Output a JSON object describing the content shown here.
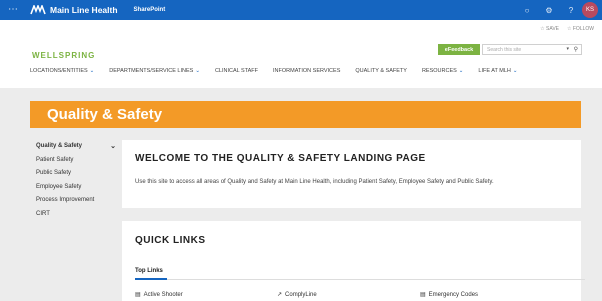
{
  "suitebar": {
    "brand": "Main Line Health",
    "app": "SharePoint",
    "avatar_initials": "KS"
  },
  "header": {
    "actions": [
      "SAVE",
      "FOLLOW"
    ],
    "logo": "WELLSPRING",
    "efeedback": "eFeedback",
    "search_placeholder": "Search this site",
    "nav": [
      {
        "label": "LOCATIONS/ENTITIES",
        "dropdown": true
      },
      {
        "label": "DEPARTMENTS/SERVICE LINES",
        "dropdown": true
      },
      {
        "label": "CLINICAL STAFF",
        "dropdown": false
      },
      {
        "label": "INFORMATION SERVICES",
        "dropdown": false
      },
      {
        "label": "QUALITY & SAFETY",
        "dropdown": false
      },
      {
        "label": "RESOURCES",
        "dropdown": true
      },
      {
        "label": "LIFE AT MLH",
        "dropdown": true
      }
    ]
  },
  "banner": {
    "title": "Quality & Safety"
  },
  "leftnav": {
    "items": [
      "Quality & Safety",
      "Patient Safety",
      "Public Safety",
      "Employee Safety",
      "Process Improvement",
      "CIRT"
    ]
  },
  "welcome": {
    "title": "WELCOME TO THE QUALITY & SAFETY LANDING PAGE",
    "text": "Use this site to access all areas of Quality and Safety at Main Line Health, including Patient Safety, Employee Safety and Public Safety."
  },
  "quick_links": {
    "title": "QUICK LINKS",
    "tab": "Top Links",
    "links": [
      "Active Shooter",
      "ComplyLine",
      "Emergency Codes"
    ]
  },
  "colors": {
    "suitebar": "#1565c0",
    "banner": "#f39a27",
    "brand_green": "#7cb342"
  }
}
